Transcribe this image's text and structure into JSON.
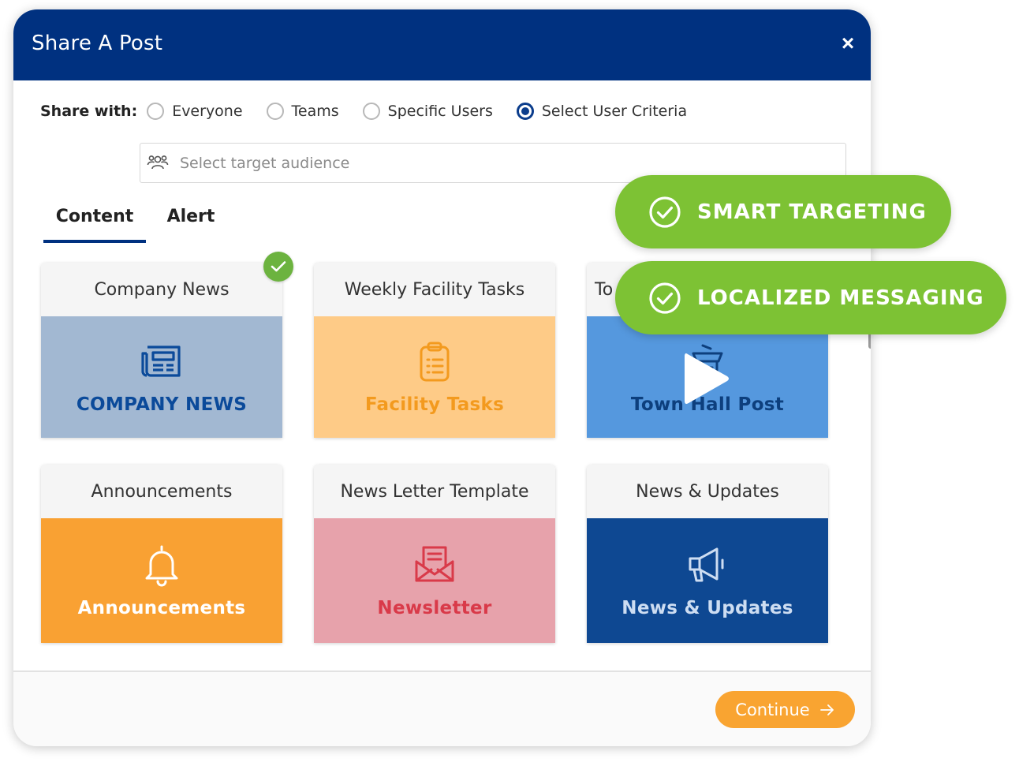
{
  "modal": {
    "title": "Share A Post",
    "close_glyph": "×"
  },
  "share": {
    "label": "Share with:",
    "options": [
      {
        "label": "Everyone",
        "checked": false
      },
      {
        "label": "Teams",
        "checked": false
      },
      {
        "label": "Specific Users",
        "checked": false
      },
      {
        "label": "Select User Criteria",
        "checked": true
      }
    ],
    "audience_placeholder": "Select target audience",
    "audience_icon": "people-icon"
  },
  "tabs": [
    {
      "label": "Content",
      "active": true
    },
    {
      "label": "Alert",
      "active": false
    }
  ],
  "cards": [
    {
      "title": "Company News",
      "label": "COMPANY NEWS",
      "icon": "newspaper-icon",
      "color": "#a2b8d2",
      "text_color": "#0b4a9a",
      "selected": true
    },
    {
      "title": "Weekly Facility Tasks",
      "label": "Facility Tasks",
      "icon": "clipboard-icon",
      "color": "#fecb87",
      "text_color": "#f39a1e",
      "selected": false
    },
    {
      "title": "To",
      "label": "Town Hall Post",
      "icon": "podium-icon",
      "color": "#5598de",
      "text_color": "#0d3f7d",
      "selected": false
    },
    {
      "title": "Announcements",
      "label": "Announcements",
      "icon": "bell-icon",
      "color": "#f9a133",
      "text_color": "#ffffff",
      "selected": false
    },
    {
      "title": "News Letter Template",
      "label": "Newsletter",
      "icon": "envelope-letter-icon",
      "color": "#e7a2ab",
      "text_color": "#d93a49",
      "selected": false
    },
    {
      "title": "News & Updates",
      "label": "News & Updates",
      "icon": "megaphone-icon",
      "color": "#0e4892",
      "text_color": "#cdddf2",
      "selected": false
    }
  ],
  "footer": {
    "continue_label": "Continue"
  },
  "badges": [
    {
      "label": "SMART TARGETING",
      "icon": "check-circle-icon"
    },
    {
      "label": "LOCALIZED MESSAGING",
      "icon": "check-circle-icon"
    }
  ],
  "colors": {
    "header": "#003180",
    "accent_orange": "#f9a431",
    "badge_green": "#7dc234",
    "check_green": "#6cb33f"
  }
}
